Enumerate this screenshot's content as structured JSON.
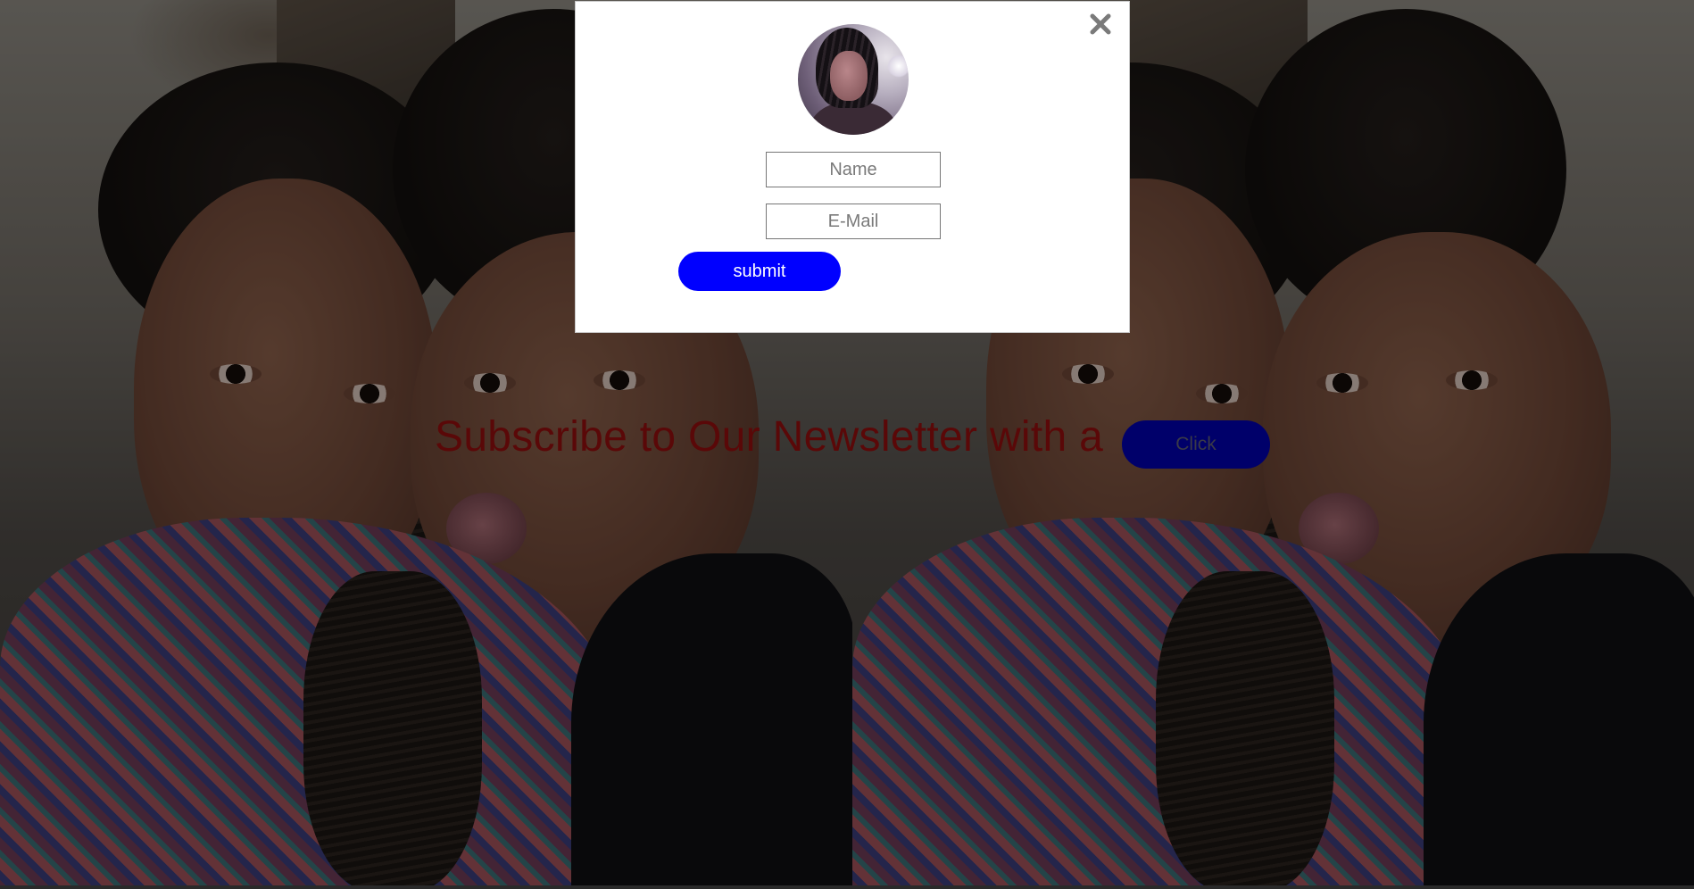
{
  "background": {
    "photo_icon": "selfie-photo"
  },
  "headline": {
    "text": "Subscribe to Our Newsletter with a",
    "color": "#5a0808"
  },
  "cta": {
    "label": "Click",
    "color": "#00006a"
  },
  "modal": {
    "close_icon": "close-x-icon",
    "avatar_icon": "profile-photo",
    "name_placeholder": "Name",
    "email_placeholder": "E-Mail",
    "submit_label": "submit",
    "submit_color": "#0000ff"
  }
}
